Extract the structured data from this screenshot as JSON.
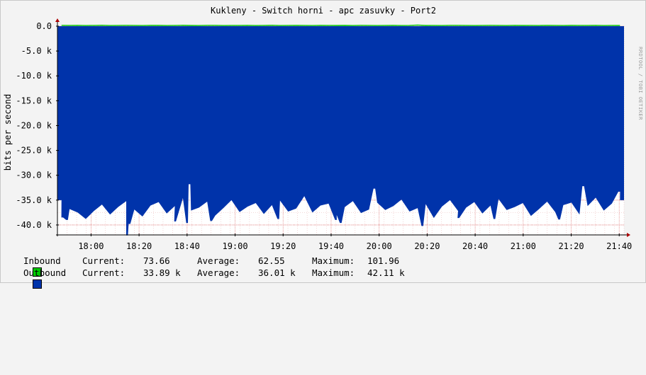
{
  "chart_data": {
    "type": "area",
    "title": "Kukleny - Switch horni - apc zasuvky - Port2",
    "ylabel": "bits per second",
    "watermark": "RRDTOOL / TOBI OETIKER",
    "ylim": [
      -42000,
      0
    ],
    "yticks": [
      {
        "value": 0,
        "label": "0.0"
      },
      {
        "value": -5000,
        "label": "-5.0 k"
      },
      {
        "value": -10000,
        "label": "-10.0 k"
      },
      {
        "value": -15000,
        "label": "-15.0 k"
      },
      {
        "value": -20000,
        "label": "-20.0 k"
      },
      {
        "value": -25000,
        "label": "-25.0 k"
      },
      {
        "value": -30000,
        "label": "-30.0 k"
      },
      {
        "value": -35000,
        "label": "-35.0 k"
      },
      {
        "value": -40000,
        "label": "-40.0 k"
      }
    ],
    "xlim": [
      "17:46",
      "21:42"
    ],
    "xticks": [
      "18:00",
      "18:20",
      "18:40",
      "19:00",
      "19:20",
      "19:40",
      "20:00",
      "20:20",
      "20:40",
      "21:00",
      "21:20",
      "21:40"
    ],
    "grid": true,
    "colors": {
      "inbound": "#00cc00",
      "outbound": "#0033aa",
      "background": "#ffffff",
      "grid": "#e8b0b0",
      "arrow": "#aa0000"
    },
    "series": [
      {
        "name": "Inbound",
        "color": "#00cc00",
        "sign": "positive",
        "values": [
          74,
          62,
          71,
          58,
          66,
          80,
          55,
          61,
          70,
          64,
          59,
          72,
          68,
          57,
          63,
          75,
          60,
          54,
          69,
          73,
          58,
          66,
          62,
          71,
          59,
          64,
          77,
          56,
          63,
          70,
          61,
          58,
          74,
          65,
          60,
          68,
          57,
          72,
          63,
          59,
          66,
          71,
          55,
          62,
          101.96,
          60,
          64,
          58,
          69,
          73,
          61,
          57,
          66,
          70,
          63,
          59,
          72,
          60,
          65,
          58,
          74,
          62,
          57,
          68,
          61,
          64,
          73,
          59,
          66,
          60
        ]
      },
      {
        "name": "Outbound",
        "color": "#0033aa",
        "sign": "negative",
        "values": [
          -35000,
          -36800,
          -37500,
          -38800,
          -37200,
          -35900,
          -37900,
          -36400,
          -35200,
          -36900,
          -38300,
          -36100,
          -35400,
          -37700,
          -36200,
          -34600,
          -37100,
          -36500,
          -35300,
          -38100,
          -36600,
          -35000,
          -37400,
          -36300,
          -35600,
          -37800,
          -36000,
          -35100,
          -37300,
          -36700,
          -34200,
          -37500,
          -36100,
          -35700,
          -38000,
          -36400,
          -35200,
          -37600,
          -36900,
          -35500,
          -37000,
          -36200,
          -34900,
          -37300,
          -36600,
          -35800,
          -38600,
          -36300,
          -35000,
          -37200,
          -36500,
          -35400,
          -37700,
          -36100,
          -34800,
          -37000,
          -36400,
          -35600,
          -38200,
          -36800,
          -35300,
          -37400,
          -36000,
          -35500,
          -37900,
          -36200,
          -34500,
          -37100,
          -35700,
          -35000
        ],
        "spikes": [
          {
            "t": "17:48",
            "v": -38500
          },
          {
            "t": "17:50",
            "v": -39000
          },
          {
            "t": "18:15",
            "v": -42110
          },
          {
            "t": "18:16",
            "v": -39800
          },
          {
            "t": "18:35",
            "v": -39300
          },
          {
            "t": "18:40",
            "v": -39600
          },
          {
            "t": "18:41",
            "v": -31800
          },
          {
            "t": "18:50",
            "v": -39200
          },
          {
            "t": "19:18",
            "v": -38800
          },
          {
            "t": "19:42",
            "v": -39000
          },
          {
            "t": "19:44",
            "v": -39600
          },
          {
            "t": "19:58",
            "v": -32700
          },
          {
            "t": "20:18",
            "v": -40200
          },
          {
            "t": "20:33",
            "v": -38600
          },
          {
            "t": "20:48",
            "v": -38800
          },
          {
            "t": "21:15",
            "v": -38900
          },
          {
            "t": "21:25",
            "v": -32200
          },
          {
            "t": "21:40",
            "v": -33300
          }
        ]
      }
    ],
    "legend": [
      {
        "name": "Inbound",
        "current_label": "Current:",
        "current": "73.66",
        "average_label": "Average:",
        "average": "62.55",
        "maximum_label": "Maximum:",
        "maximum": "101.96",
        "color": "#00cc00"
      },
      {
        "name": "Outbound",
        "current_label": "Current:",
        "current": "33.89 k",
        "average_label": "Average:",
        "average": "36.01 k",
        "maximum_label": "Maximum:",
        "maximum": "42.11 k",
        "color": "#0033aa"
      }
    ]
  }
}
